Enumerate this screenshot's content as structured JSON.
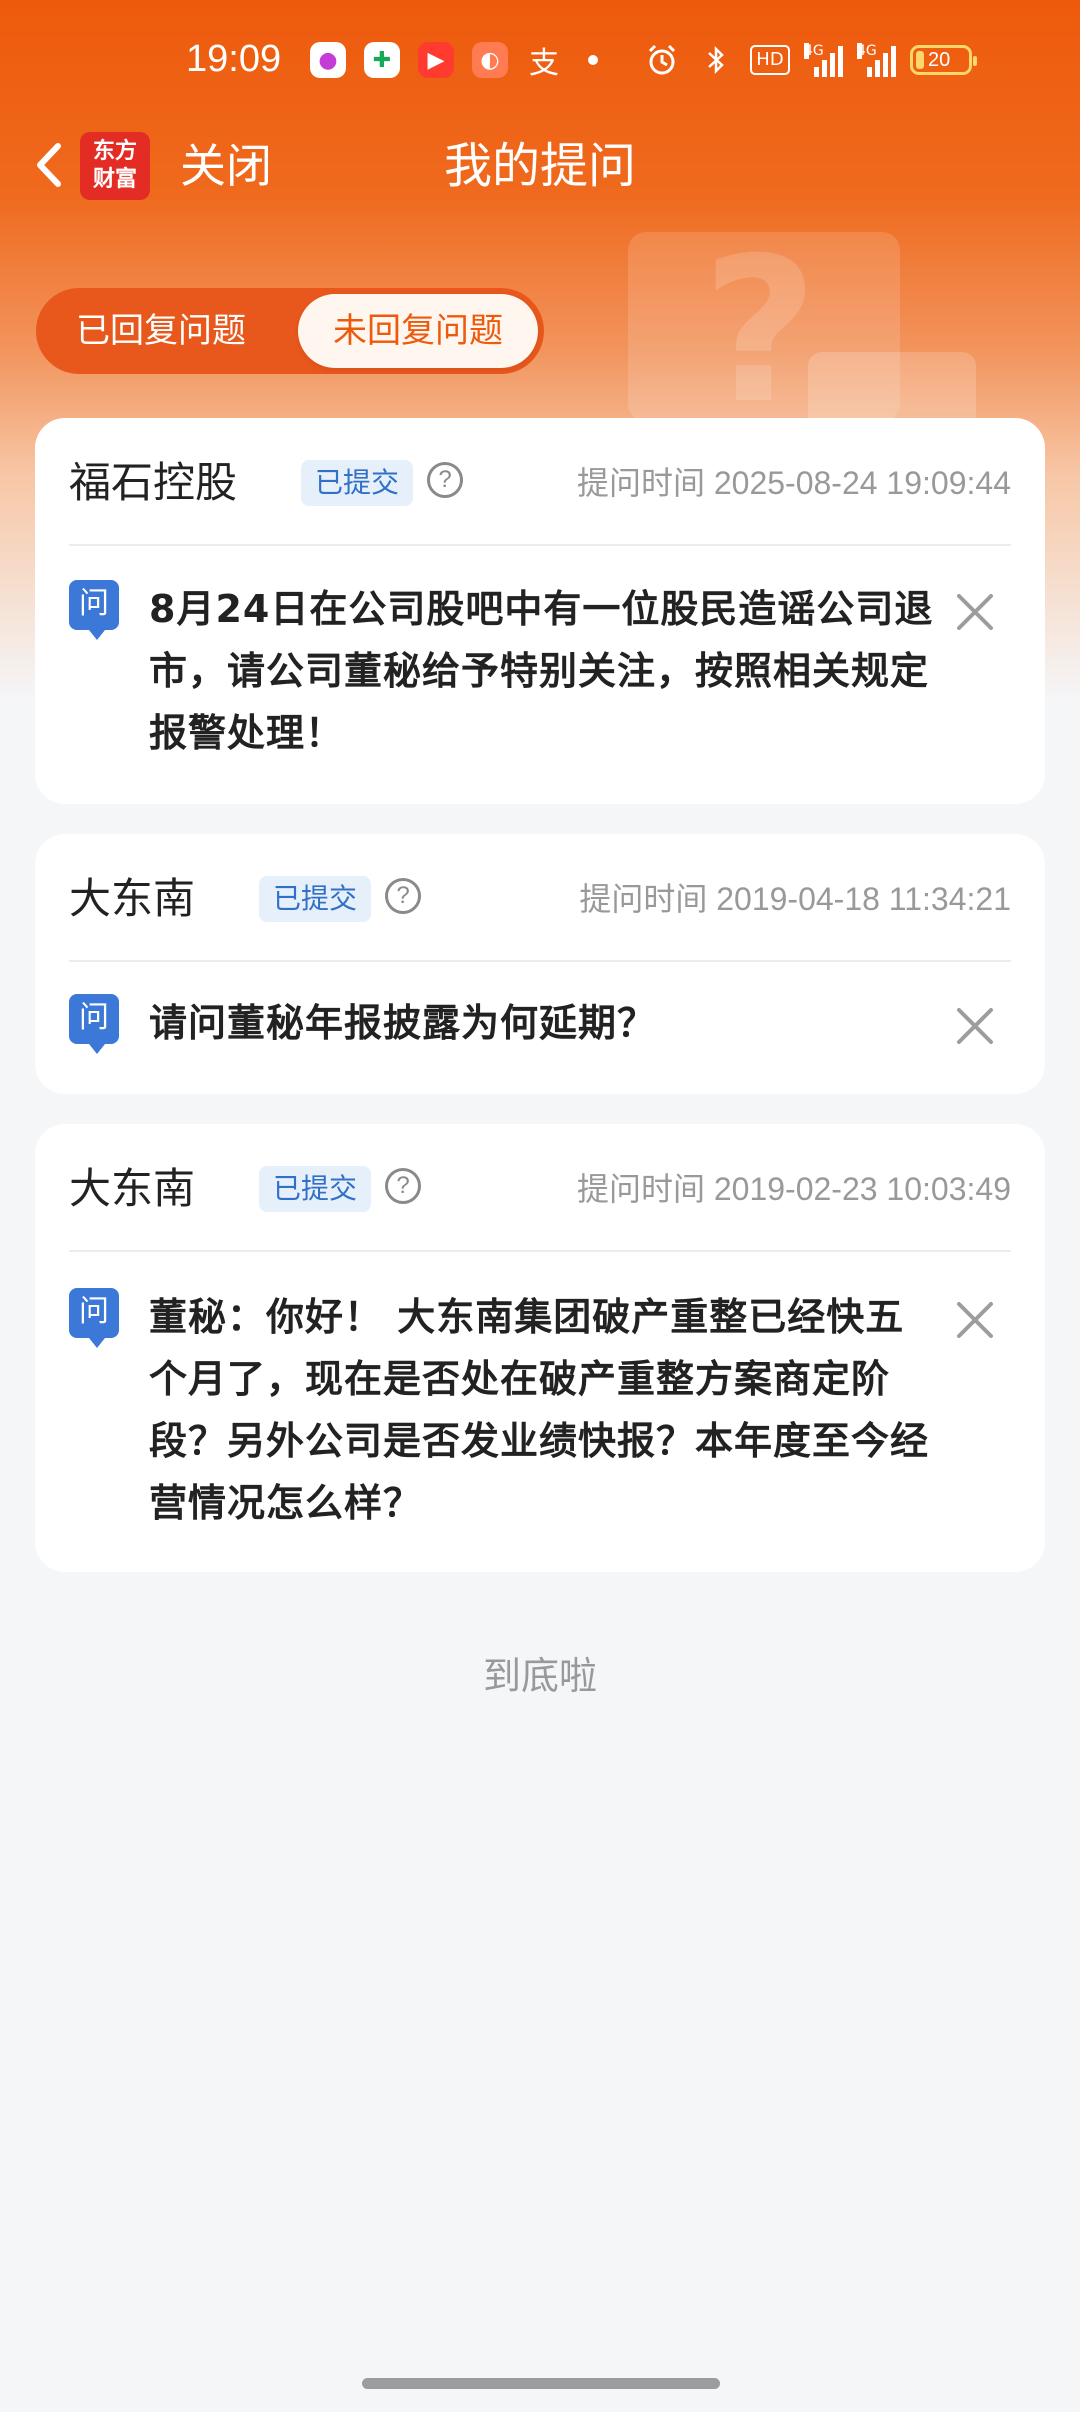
{
  "status_bar": {
    "time": "19:09",
    "hd_label": "HD",
    "signal_label_1": "4G",
    "signal_label_2": "4G",
    "battery": "20",
    "app_icon_5": "支"
  },
  "nav": {
    "brand_line_1": "东方",
    "brand_line_2": "财富",
    "close_label": "关闭",
    "title": "我的提问"
  },
  "tabs": [
    {
      "label": "已回复问题"
    },
    {
      "label": "未回复问题"
    }
  ],
  "questions": [
    {
      "company": "福石控股",
      "status": "已提交",
      "time": "提问时间 2025-08-24 19:09:44",
      "icon_label": "问",
      "text": "8月24日在公司股吧中有一位股民造谣公司退市，请公司董秘给予特别关注，按照相关规定报警处理！"
    },
    {
      "company": "大东南",
      "status": "已提交",
      "time": "提问时间 2019-04-18 11:34:21",
      "icon_label": "问",
      "text": "请问董秘年报披露为何延期？"
    },
    {
      "company": "大东南",
      "status": "已提交",
      "time": "提问时间 2019-02-23 10:03:49",
      "icon_label": "问",
      "text": "董秘：你好！ 大东南集团破产重整已经快五个月了，现在是否处在破产重整方案商定阶段？另外公司是否发业绩快报？本年度至今经营情况怎么样？"
    }
  ],
  "footer": {
    "end_text": "到底啦"
  },
  "colors": {
    "brand_orange": "#ee5a0c",
    "badge_blue": "#3270c8",
    "question_icon_blue": "#3b78d8"
  }
}
